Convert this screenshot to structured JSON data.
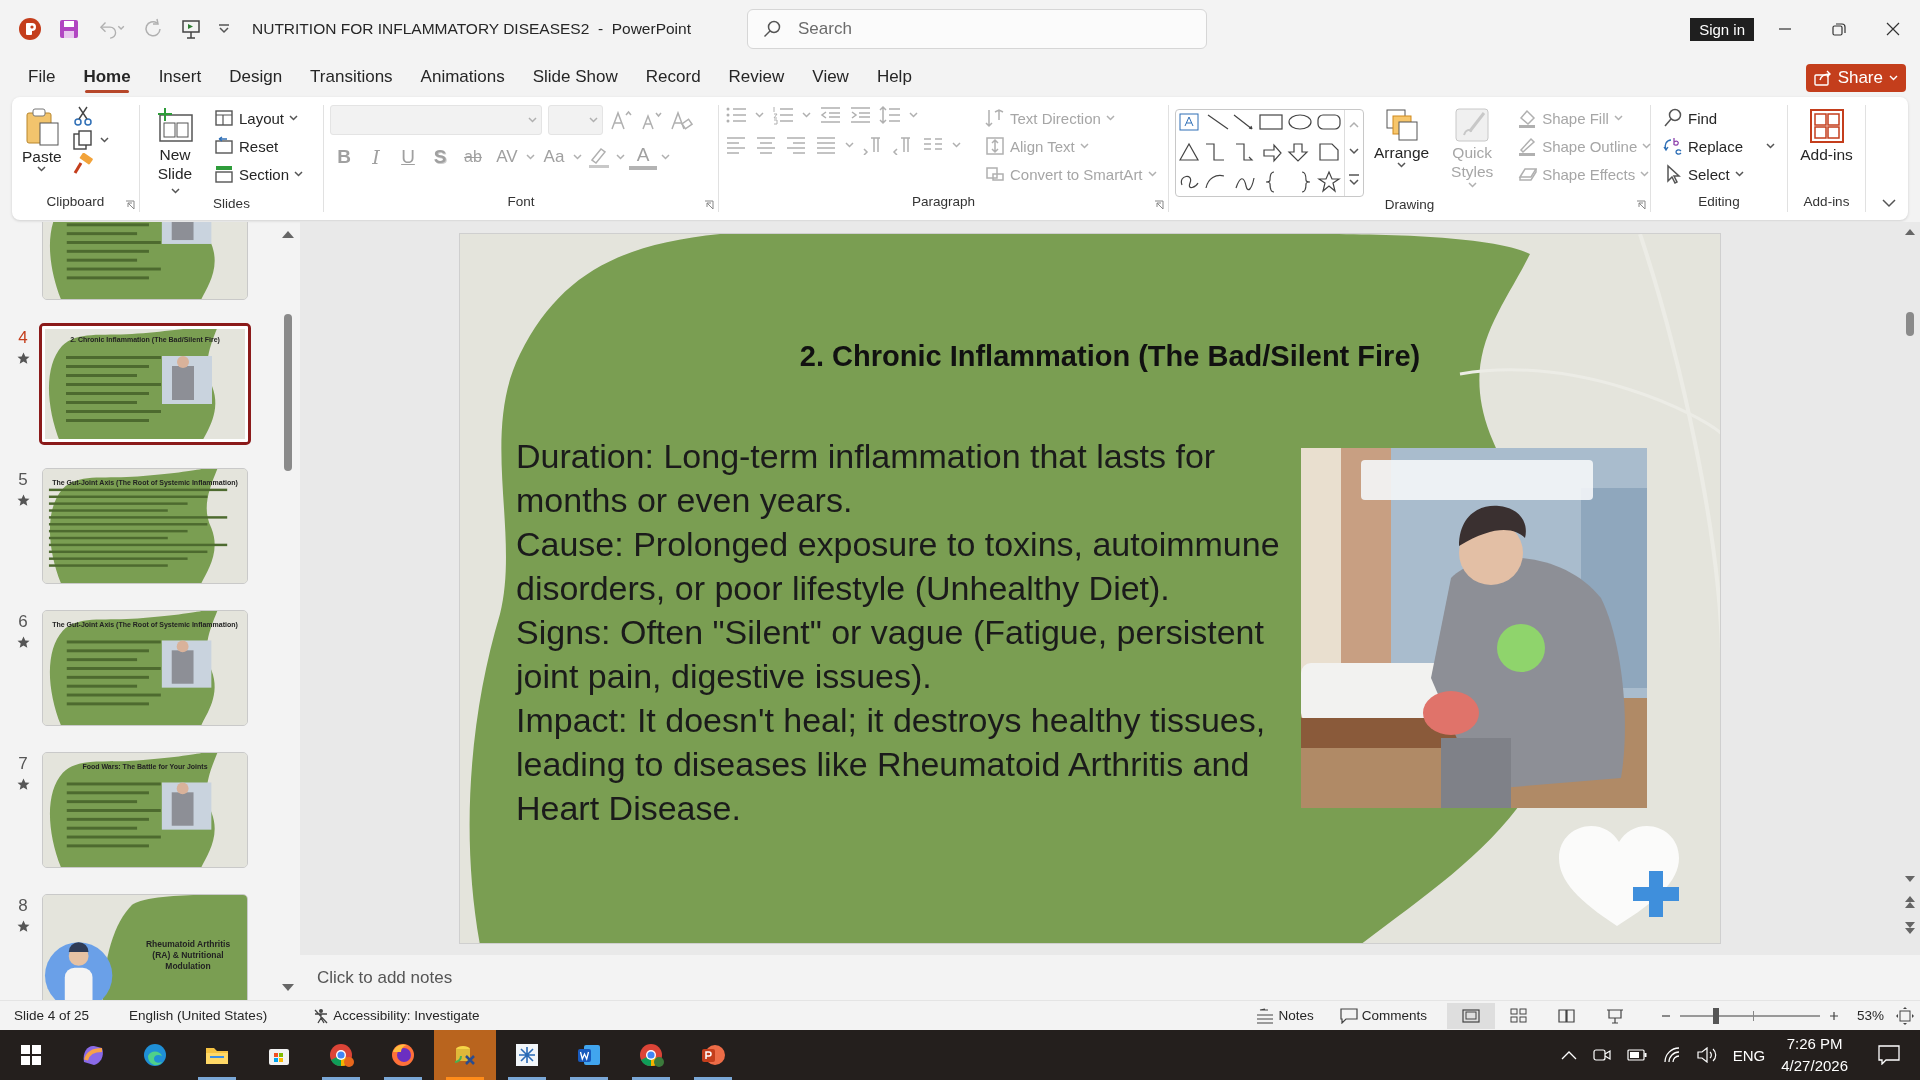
{
  "window": {
    "title": "NUTRITION FOR INFLAMMATORY DISEASES2  -  PowerPoint",
    "search": {
      "placeholder": "Search"
    },
    "sign_in": "Sign in"
  },
  "tabs": [
    {
      "label": "File",
      "selected": false
    },
    {
      "label": "Home",
      "selected": true
    },
    {
      "label": "Insert",
      "selected": false
    },
    {
      "label": "Design",
      "selected": false
    },
    {
      "label": "Transitions",
      "selected": false
    },
    {
      "label": "Animations",
      "selected": false
    },
    {
      "label": "Slide Show",
      "selected": false
    },
    {
      "label": "Record",
      "selected": false
    },
    {
      "label": "Review",
      "selected": false
    },
    {
      "label": "View",
      "selected": false
    },
    {
      "label": "Help",
      "selected": false
    }
  ],
  "share": "Share",
  "ribbon": {
    "groups": [
      {
        "label": "Clipboard",
        "buttons": [
          {
            "label": "Paste",
            "disabled": false
          }
        ]
      },
      {
        "label": "Slides",
        "buttons": [
          {
            "label": "New Slide",
            "disabled": false
          },
          {
            "label": "Layout",
            "disabled": false
          },
          {
            "label": "Reset",
            "disabled": false
          },
          {
            "label": "Section",
            "disabled": false
          }
        ]
      },
      {
        "label": "Font",
        "buttons": [
          {
            "label": "B",
            "kind": "bold",
            "disabled": true
          },
          {
            "label": "I",
            "kind": "italic",
            "disabled": true
          },
          {
            "label": "U",
            "kind": "underline",
            "disabled": true
          },
          {
            "label": "S",
            "kind": "shadow",
            "disabled": true
          },
          {
            "label": "ab",
            "kind": "strike",
            "disabled": true
          },
          {
            "label": "AV",
            "kind": "spacing",
            "disabled": true
          },
          {
            "label": "Aa",
            "kind": "case",
            "disabled": true
          },
          {
            "label": "A",
            "kind": "color",
            "disabled": true
          }
        ]
      },
      {
        "label": "Paragraph",
        "buttons": [
          {
            "label": "Text Direction",
            "disabled": true
          },
          {
            "label": "Align Text",
            "disabled": true
          },
          {
            "label": "Convert to SmartArt",
            "disabled": true
          }
        ]
      },
      {
        "label": "Drawing",
        "buttons": [
          {
            "label": "Arrange",
            "disabled": false
          },
          {
            "label": "Quick Styles",
            "disabled": true
          },
          {
            "label": "Shape Fill",
            "disabled": true
          },
          {
            "label": "Shape Outline",
            "disabled": true
          },
          {
            "label": "Shape Effects",
            "disabled": true
          }
        ]
      },
      {
        "label": "Editing",
        "buttons": [
          {
            "label": "Find",
            "disabled": false
          },
          {
            "label": "Replace",
            "disabled": false
          },
          {
            "label": "Select",
            "disabled": false
          }
        ]
      },
      {
        "label": "Add-ins",
        "buttons": [
          {
            "label": "Add-ins",
            "disabled": false
          }
        ]
      }
    ]
  },
  "thumbnails": [
    {
      "kind": "text_image",
      "selected": false
    },
    {
      "number": "4",
      "title": "2. Chronic Inflammation (The Bad/Silent Fire)",
      "kind": "text_image",
      "selected": true
    },
    {
      "number": "5",
      "title": "The Gut-Joint Axis (The Root of Systemic Inflammation)",
      "kind": "text",
      "selected": false
    },
    {
      "number": "6",
      "title": "The Gut-Joint Axis (The Root of Systemic Inflammation)",
      "kind": "text_image",
      "selected": false
    },
    {
      "number": "7",
      "title": "Food Wars: The Battle for Your Joints",
      "kind": "text_image",
      "selected": false
    },
    {
      "number": "8",
      "title": "Rheumatoid Arthritis (RA) & Nutritional Modulation",
      "kind": "title",
      "selected": false
    }
  ],
  "slide": {
    "title": "2. Chronic Inflammation (The Bad/Silent Fire)",
    "paragraphs": [
      "Duration: Long-term inflammation that lasts for months or even years.",
      "Cause: Prolonged exposure to toxins, autoimmune disorders, or poor lifestyle (Unhealthy Diet).",
      "Signs: Often \"Silent\" or vague (Fatigue, persistent joint pain, digestive issues).",
      "Impact: It doesn't heal; it destroys healthy tissues, leading to diseases like Rheumatoid Arthritis and Heart Disease."
    ],
    "image": {
      "kind": "picture"
    }
  },
  "notes": {
    "placeholder": "Click to add notes"
  },
  "status_bar": {
    "slide": "Slide 4 of 25",
    "language": "English (United States)",
    "accessibility": "Accessibility: Investigate",
    "notes": "Notes",
    "comments": "Comments",
    "views": [
      {
        "selected": true
      },
      {
        "selected": false
      },
      {
        "selected": false
      },
      {
        "selected": false
      }
    ],
    "zoom": {
      "level": 0.26,
      "reading": "53%"
    }
  },
  "taskbar": {
    "apps": [
      {
        "running": false,
        "selected": false
      },
      {
        "running": false,
        "selected": false
      },
      {
        "running": true,
        "selected": false
      },
      {
        "running": false,
        "selected": false
      },
      {
        "running": true,
        "selected": false
      },
      {
        "running": true,
        "selected": false
      },
      {
        "running": true,
        "selected": true
      },
      {
        "running": true,
        "selected": false
      },
      {
        "running": true,
        "selected": false
      },
      {
        "running": true,
        "selected": false
      },
      {
        "running": true,
        "selected": false
      }
    ],
    "language": "ENG",
    "time": "7:26 PM",
    "date": "4/27/2026"
  }
}
